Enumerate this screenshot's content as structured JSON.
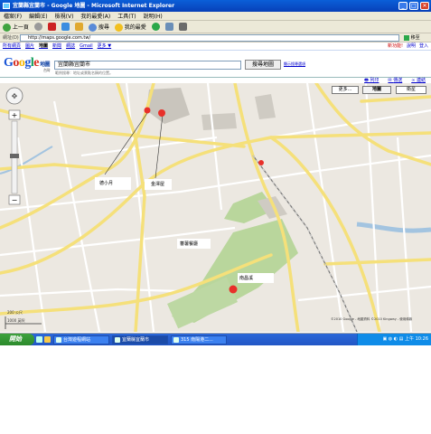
{
  "window": {
    "title": "宜蘭縣宜蘭市 - Google 地圖 - Microsoft Internet Explorer",
    "controls": {
      "min": "_",
      "max": "□",
      "close": "✕"
    }
  },
  "menu": [
    "檔案(F)",
    "編輯(E)",
    "檢視(V)",
    "我的最愛(A)",
    "工具(T)",
    "說明(H)"
  ],
  "toolbar": {
    "back": "上一頁",
    "search": "搜尋",
    "favorites": "我的最愛"
  },
  "address": {
    "label": "網址(D)",
    "url": "http://maps.google.com.tw/",
    "go": "移至"
  },
  "gbar": {
    "links": [
      "所有網頁",
      "圖片",
      "地圖",
      "新聞",
      "網誌",
      "Gmail",
      "更多 ▼"
    ],
    "current": "地圖",
    "right": [
      "新功能!",
      "說明",
      "登入"
    ]
  },
  "search": {
    "logo_google": "Google",
    "logo_sub": "地圖",
    "logo_region": "台灣",
    "value": "宜蘭縣宜蘭市",
    "button": "搜尋地圖",
    "advanced": "顯示搜尋選項",
    "hint": "範例搜尋：地址或景點名稱的位置。"
  },
  "map_links": [
    "列印",
    "傳送",
    "連結"
  ],
  "map": {
    "types": {
      "more": "更多...",
      "map": "地圖",
      "satellite": "衛星"
    },
    "labels": {
      "label1": "德小月",
      "label2": "金澤屋",
      "label3": "蕃薯餐廳",
      "label4": "南昌溪"
    },
    "scale_top": "200 公尺",
    "scale_bottom": "1000 英呎",
    "copyright": "©2010 Google - 地圖資料 ©2010 Kingway - 使用條款"
  },
  "statusbar": {
    "text": "完成",
    "zone": "Internet"
  },
  "taskbar": {
    "start": "開始",
    "tasks": [
      "台灣遊程網站",
      "宜蘭縣宜蘭市",
      "315 南陽港二..."
    ],
    "clock": "上午 10:26"
  },
  "colors": {
    "road_major": "#f5e07a",
    "road_minor": "#ffffff",
    "park": "#b9d69c",
    "water": "#a3c4e0",
    "marker": "#e8302a"
  }
}
